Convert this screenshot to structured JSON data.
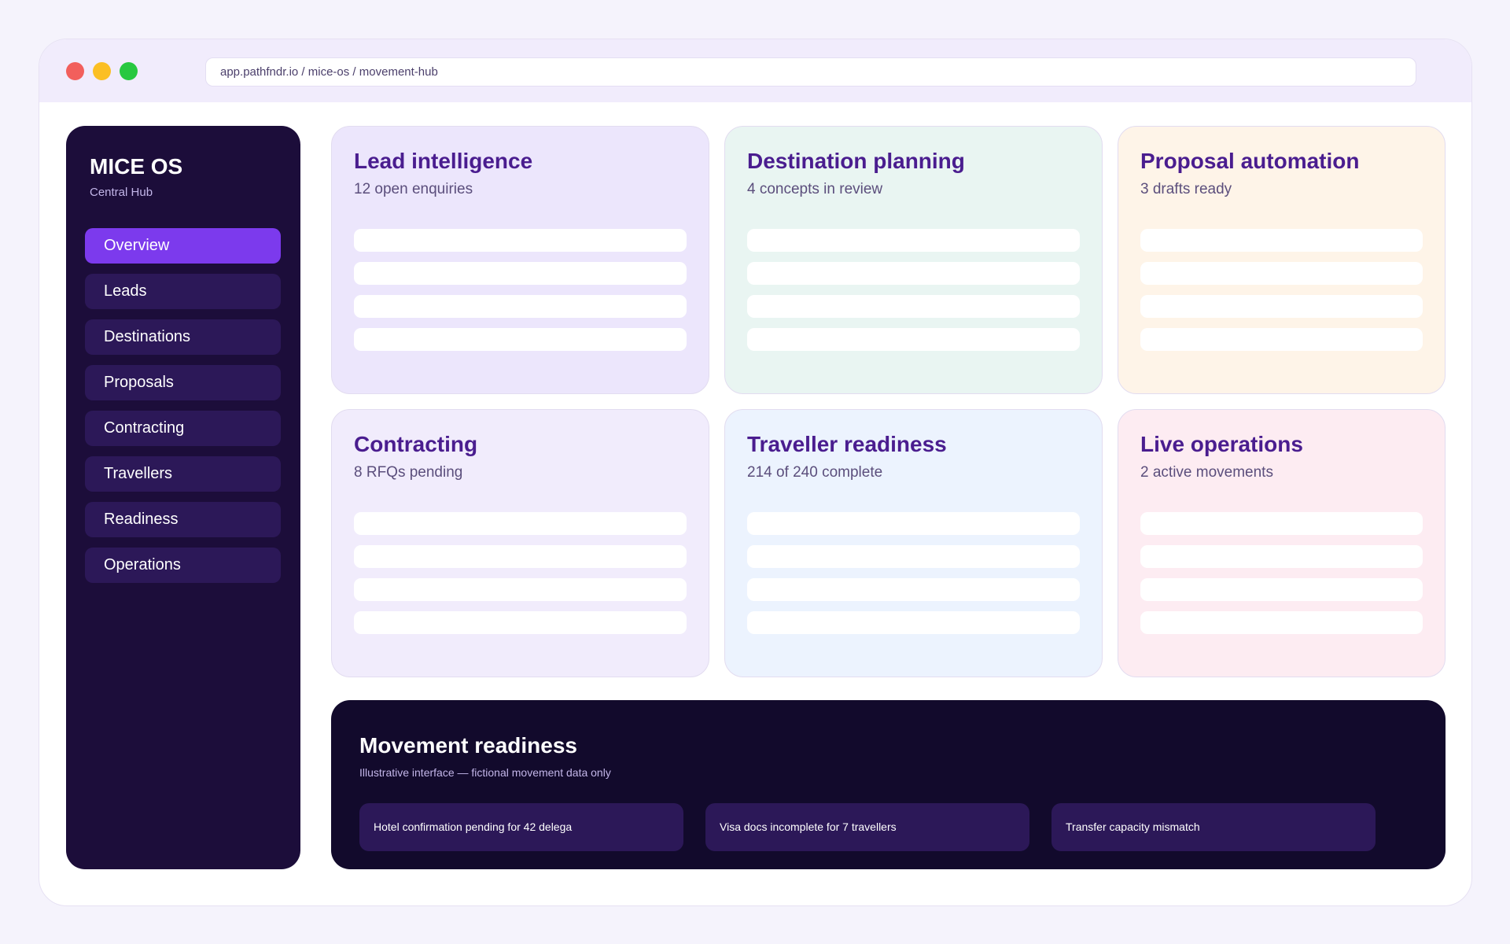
{
  "browser": {
    "url": "app.pathfndr.io / mice-os / movement-hub"
  },
  "sidebar": {
    "title": "MICE OS",
    "subtitle": "Central Hub",
    "items": [
      {
        "label": "Overview"
      },
      {
        "label": "Leads"
      },
      {
        "label": "Destinations"
      },
      {
        "label": "Proposals"
      },
      {
        "label": "Contracting"
      },
      {
        "label": "Travellers"
      },
      {
        "label": "Readiness"
      },
      {
        "label": "Operations"
      }
    ],
    "active_item": "Overview"
  },
  "cards": [
    {
      "title": "Lead intelligence",
      "subtitle": "12 open enquiries"
    },
    {
      "title": "Destination planning",
      "subtitle": "4 concepts in review"
    },
    {
      "title": "Proposal automation",
      "subtitle": "3 drafts ready"
    },
    {
      "title": "Contracting",
      "subtitle": "8 RFQs pending"
    },
    {
      "title": "Traveller readiness",
      "subtitle": "214 of 240 complete"
    },
    {
      "title": "Live operations",
      "subtitle": "2 active movements"
    }
  ],
  "readiness": {
    "title": "Movement readiness",
    "note": "Illustrative interface — fictional movement data only",
    "alerts": [
      "Hotel confirmation pending for 42 delega",
      "Visa docs incomplete for 7 travellers",
      "Transfer capacity mismatch"
    ]
  },
  "colors": {
    "accent": "#7c3aed",
    "sidebar_bg": "#1c0d3a",
    "card_title": "#4a1d8f"
  }
}
